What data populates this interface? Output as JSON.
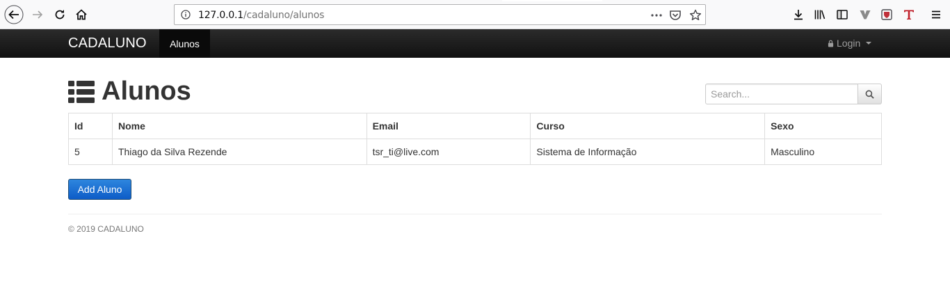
{
  "browser": {
    "url_host": "127.0.0.1",
    "url_path": "/cadaluno/alunos"
  },
  "navbar": {
    "brand": "CADALUNO",
    "active_item": "Alunos",
    "login_label": "Login"
  },
  "page": {
    "title": "Alunos",
    "search_placeholder": "Search..."
  },
  "table": {
    "headers": [
      "Id",
      "Nome",
      "Email",
      "Curso",
      "Sexo"
    ],
    "rows": [
      [
        "5",
        "Thiago da Silva Rezende",
        "tsr_ti@live.com",
        "Sistema de Informação",
        "Masculino"
      ]
    ]
  },
  "actions": {
    "add_label": "Add Aluno"
  },
  "footer": {
    "text": "© 2019 CADALUNO"
  }
}
